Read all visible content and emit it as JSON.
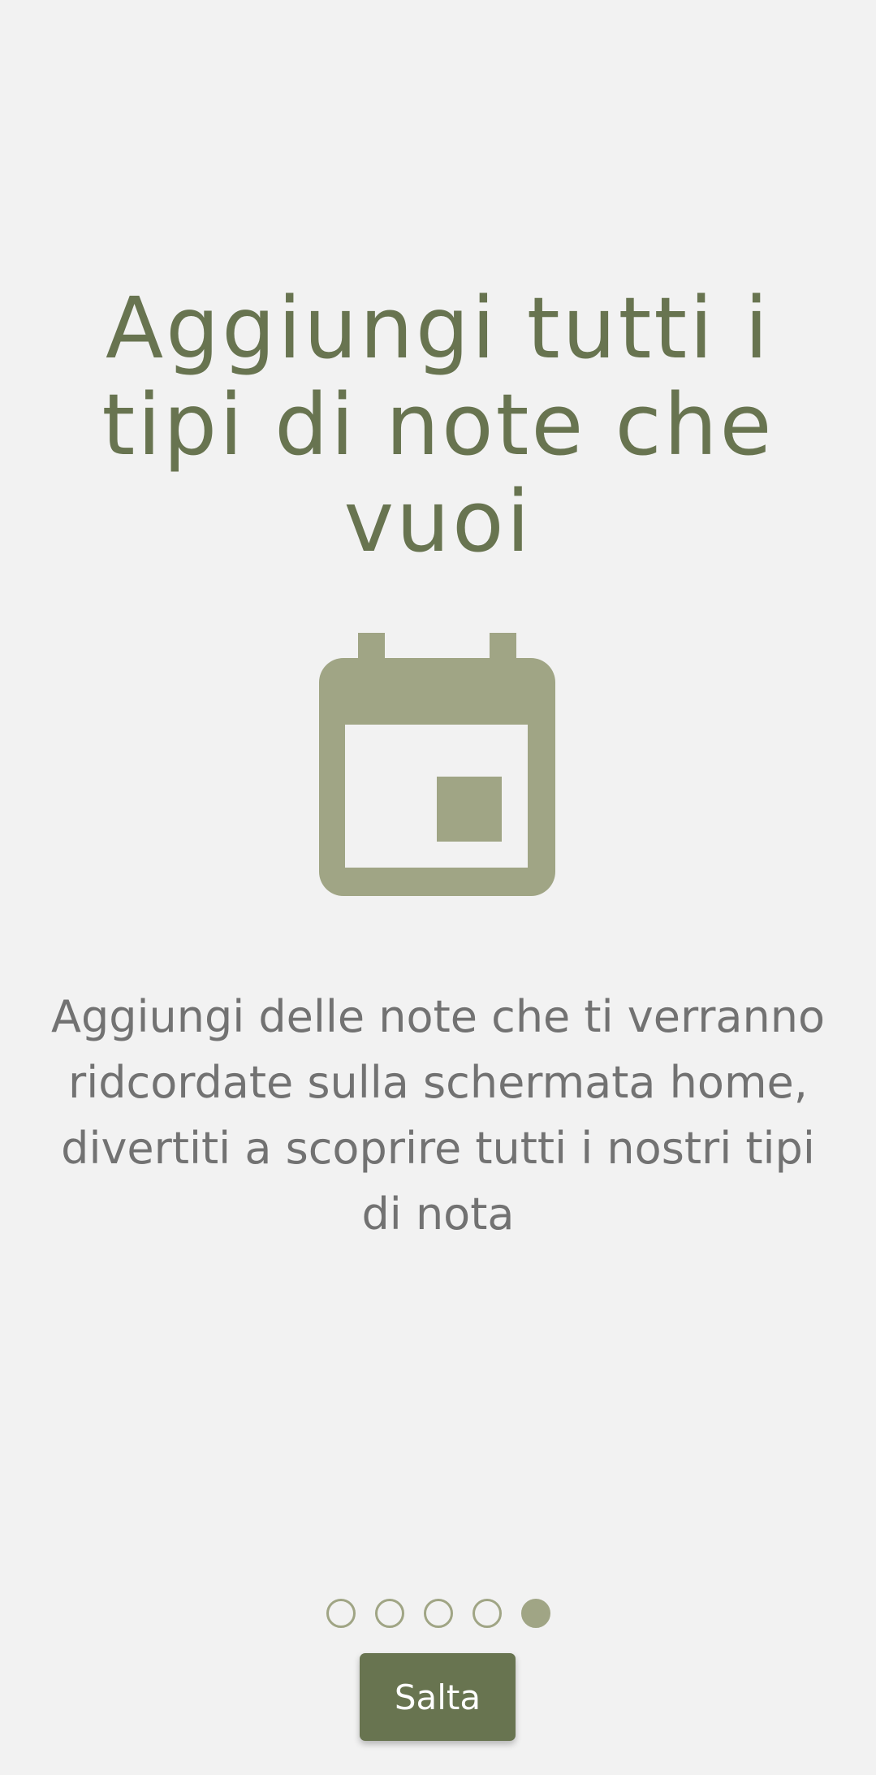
{
  "onboarding": {
    "title": "Aggiungi tutti i tipi di note che vuoi",
    "description": "Aggiungi delle note che ti verranno ridcordate sulla schermata home, divertiti a scoprire tutti i nostri tipi di nota",
    "icon": "calendar-icon",
    "pager": {
      "total": 5,
      "current": 5
    },
    "skip_label": "Salta"
  },
  "colors": {
    "background": "#f2f2f2",
    "title": "#687450",
    "icon": "#a0a585",
    "description": "#727272",
    "button": "#687450",
    "button_text": "#ffffff",
    "dot": "#a0a585"
  }
}
